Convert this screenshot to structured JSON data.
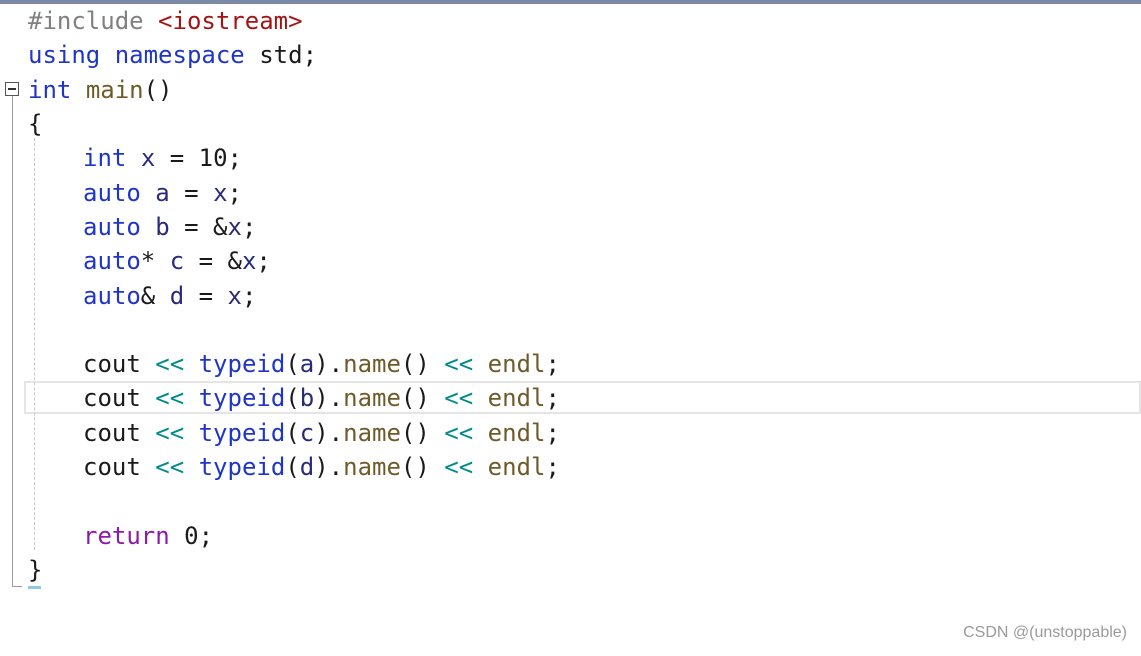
{
  "editor": {
    "include": {
      "directive": "#include",
      "header": "<iostream>"
    },
    "using": {
      "kw1": "using",
      "kw2": "namespace",
      "ns": "std",
      "semi": ";"
    },
    "main_sig": {
      "type": "int",
      "name": "main",
      "parens": "()"
    },
    "open_brace": "{",
    "decl_x": {
      "type": "int",
      "name": "x",
      "rest": " = 10;"
    },
    "decl_a": {
      "type": "auto",
      "name": "a",
      "eq": " = ",
      "val": "x",
      "semi": ";"
    },
    "decl_b": {
      "type": "auto",
      "name": "b",
      "eq": " = &",
      "val": "x",
      "semi": ";"
    },
    "decl_c": {
      "type": "auto",
      "ptr": "*",
      "name": "c",
      "eq": " = &",
      "val": "x",
      "semi": ";"
    },
    "decl_d": {
      "type": "auto",
      "ref": "&",
      "name": "d",
      "eq": " = ",
      "val": "x",
      "semi": ";"
    },
    "couts": [
      {
        "cout": "cout",
        "op1": "<<",
        "typeid": "typeid",
        "open": "(",
        "arg": "a",
        "close": ").",
        "name": "name",
        "call": "()",
        "op2": "<<",
        "endl": "endl",
        "semi": ";"
      },
      {
        "cout": "cout",
        "op1": "<<",
        "typeid": "typeid",
        "open": "(",
        "arg": "b",
        "close": ").",
        "name": "name",
        "call": "()",
        "op2": "<<",
        "endl": "endl",
        "semi": ";"
      },
      {
        "cout": "cout",
        "op1": "<<",
        "typeid": "typeid",
        "open": "(",
        "arg": "c",
        "close": ").",
        "name": "name",
        "call": "()",
        "op2": "<<",
        "endl": "endl",
        "semi": ";"
      },
      {
        "cout": "cout",
        "op1": "<<",
        "typeid": "typeid",
        "open": "(",
        "arg": "d",
        "close": ").",
        "name": "name",
        "call": "()",
        "op2": "<<",
        "endl": "endl",
        "semi": ";"
      }
    ],
    "ret": {
      "kw": "return",
      "val": "0",
      "semi": ";"
    },
    "close_brace": "}"
  },
  "watermark": "CSDN @(unstoppable)",
  "colors": {
    "keyword": "#1f35c8",
    "preprocessor": "#808080",
    "string_header": "#a31515",
    "function": "#6f5b2a",
    "variable": "#2a2a7a",
    "operator": "#008b8b",
    "return_keyword": "#8e1aa8"
  }
}
